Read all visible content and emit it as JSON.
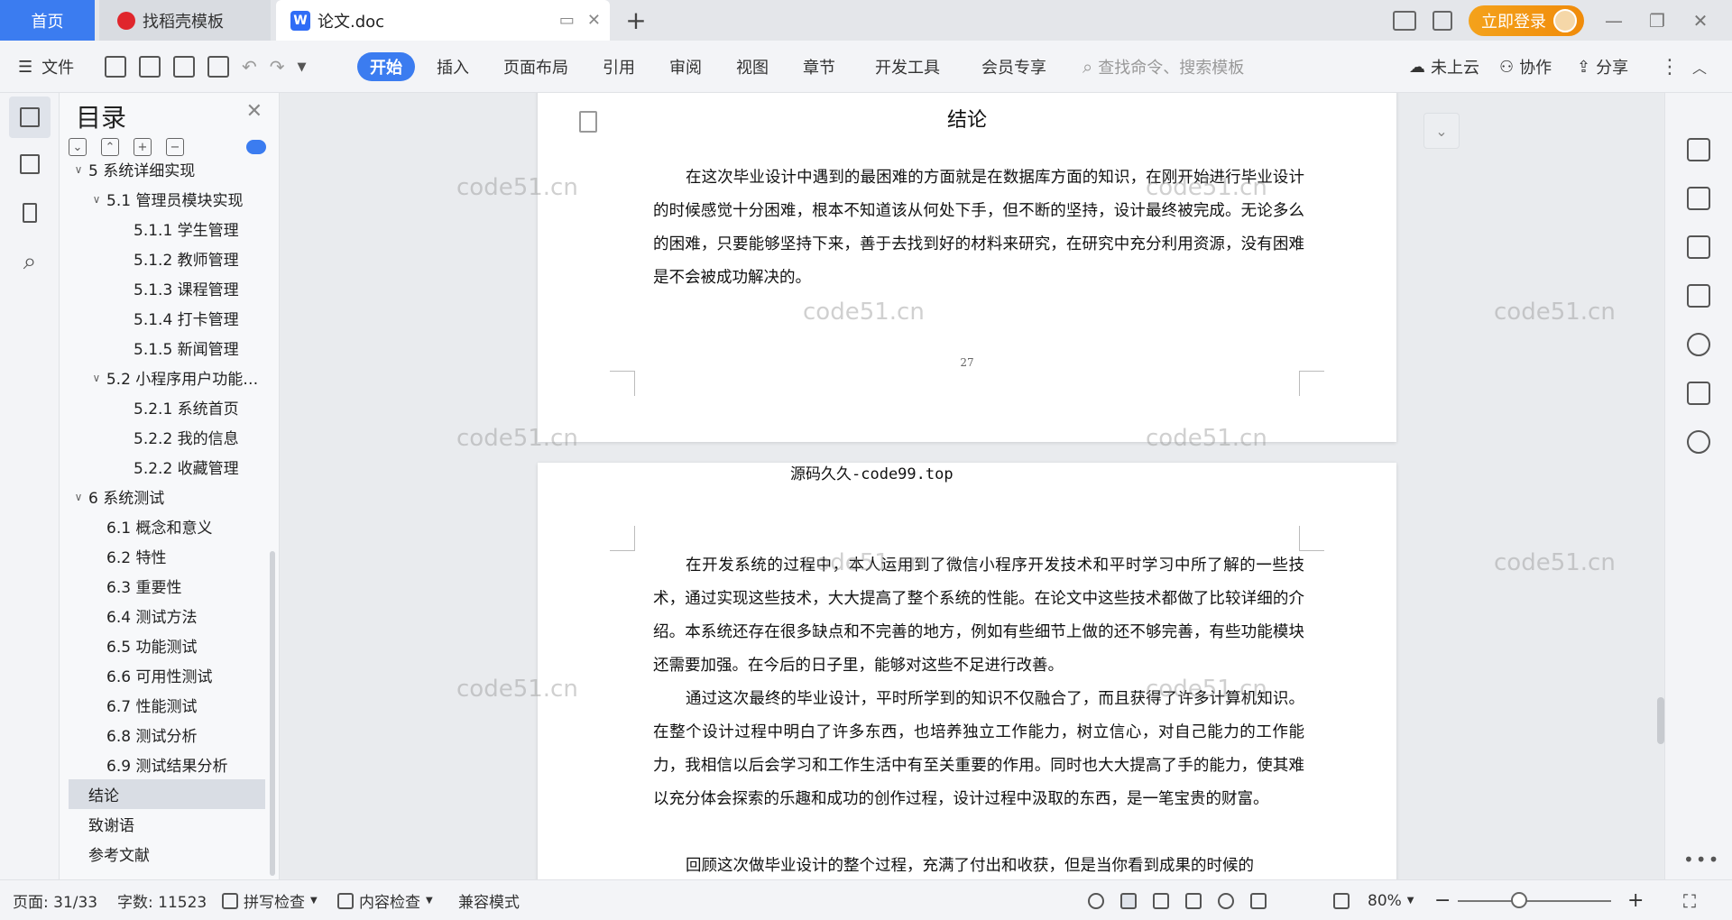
{
  "titlebar": {
    "tab_home": "首页",
    "tab_daoke": "找稻壳模板",
    "tab_doc": "论文.doc",
    "tab_new": "+",
    "login_label": "立即登录",
    "accent_color": "#3b7cf0"
  },
  "ribbon": {
    "file": "文件",
    "tabs": [
      "开始",
      "插入",
      "页面布局",
      "引用",
      "审阅",
      "视图",
      "章节",
      "开发工具",
      "会员专享"
    ],
    "search_placeholder": "查找命令、搜索模板",
    "cloud": "未上云",
    "collab": "协作",
    "share": "分享"
  },
  "toc": {
    "title": "目录",
    "items": [
      {
        "label": "5 系统详细实现",
        "level": 1,
        "caret": "down"
      },
      {
        "label": "5.1 管理员模块实现",
        "level": 2,
        "caret": "down"
      },
      {
        "label": "5.1.1 学生管理",
        "level": 3
      },
      {
        "label": "5.1.2 教师管理",
        "level": 3
      },
      {
        "label": "5.1.3 课程管理",
        "level": 3
      },
      {
        "label": "5.1.4 打卡管理",
        "level": 3
      },
      {
        "label": "5.1.5 新闻管理",
        "level": 3
      },
      {
        "label": "5.2 小程序用户功能实现",
        "level": 2,
        "caret": "down"
      },
      {
        "label": "5.2.1 系统首页",
        "level": 3
      },
      {
        "label": "5.2.2 我的信息",
        "level": 3
      },
      {
        "label": "5.2.2 收藏管理",
        "level": 3
      },
      {
        "label": "6 系统测试",
        "level": 1,
        "caret": "down"
      },
      {
        "label": "6.1 概念和意义",
        "level": 2
      },
      {
        "label": "6.2 特性",
        "level": 2
      },
      {
        "label": "6.3 重要性",
        "level": 2
      },
      {
        "label": "6.4 测试方法",
        "level": 2
      },
      {
        "label": "6.5 功能测试",
        "level": 2
      },
      {
        "label": "6.6 可用性测试",
        "level": 2
      },
      {
        "label": "6.7 性能测试",
        "level": 2
      },
      {
        "label": "6.8 测试分析",
        "level": 2
      },
      {
        "label": "6.9 测试结果分析",
        "level": 2
      },
      {
        "label": "结论",
        "level": 1,
        "selected": true
      },
      {
        "label": "致谢语",
        "level": 1
      },
      {
        "label": "参考文献",
        "level": 1
      }
    ]
  },
  "document": {
    "heading": "结论",
    "page1_para": "在这次毕业设计中遇到的最困难的方面就是在数据库方面的知识，在刚开始进行毕业设计的时候感觉十分困难，根本不知道该从何处下手，但不断的坚持，设计最终被完成。无论多么的困难，只要能够坚持下来，善于去找到好的材料来研究，在研究中充分利用资源，没有困难是不会被成功解决的。",
    "page_number": "27",
    "between_pages": "源码久久-code99.top",
    "page2_para1": "在开发系统的过程中，本人运用到了微信小程序开发技术和平时学习中所了解的一些技术，通过实现这些技术，大大提高了整个系统的性能。在论文中这些技术都做了比较详细的介绍。本系统还存在很多缺点和不完善的地方，例如有些细节上做的还不够完善，有些功能模块还需要加强。在今后的日子里，能够对这些不足进行改善。",
    "page2_para2": "通过这次最终的毕业设计，平时所学到的知识不仅融合了，而且获得了许多计算机知识。在整个设计过程中明白了许多东西，也培养独立工作能力，树立信心，对自己能力的工作能力，我相信以后会学习和工作生活中有至关重要的作用。同时也大大提高了手的能力，使其难以充分体会探索的乐趣和成功的创作过程，设计过程中汲取的东西，是一笔宝贵的财富。",
    "page2_para3": "回顾这次做毕业设计的整个过程，充满了付出和收获，但是当你看到成果的时候的",
    "watermark": "code51.cn"
  },
  "statusbar": {
    "page": "页面: 31/33",
    "words": "字数: 11523",
    "spell": "拼写检查",
    "content": "内容检查",
    "compat": "兼容模式",
    "zoom": "80%",
    "zoom_level": 0.4
  }
}
